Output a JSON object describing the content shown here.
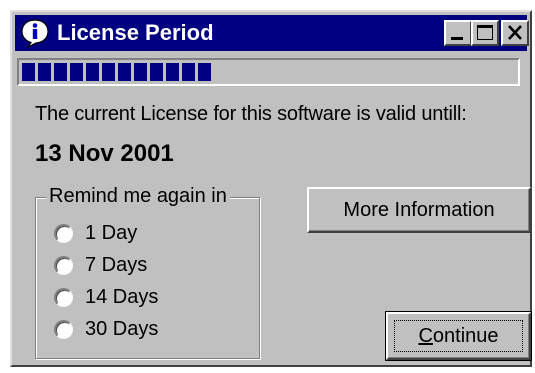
{
  "window": {
    "title": "License Period",
    "title_icon": "info-icon",
    "controls": {
      "minimize": "minimize-icon",
      "maximize": "maximize-icon",
      "close": "close-icon"
    }
  },
  "progress": {
    "value": 0.38,
    "color": "#000080"
  },
  "message": {
    "text": "The current License for this software is valid untill:",
    "date": "13 Nov 2001"
  },
  "remind": {
    "legend": "Remind me again in",
    "options": [
      {
        "label": "1 Day",
        "selected": false
      },
      {
        "label": "7 Days",
        "selected": false
      },
      {
        "label": "14 Days",
        "selected": false
      },
      {
        "label": "30 Days",
        "selected": false
      }
    ]
  },
  "buttons": {
    "more_info": "More Information",
    "continue": "Continue"
  },
  "colors": {
    "titlebar": "#000080",
    "face": "#c0c0c0"
  }
}
